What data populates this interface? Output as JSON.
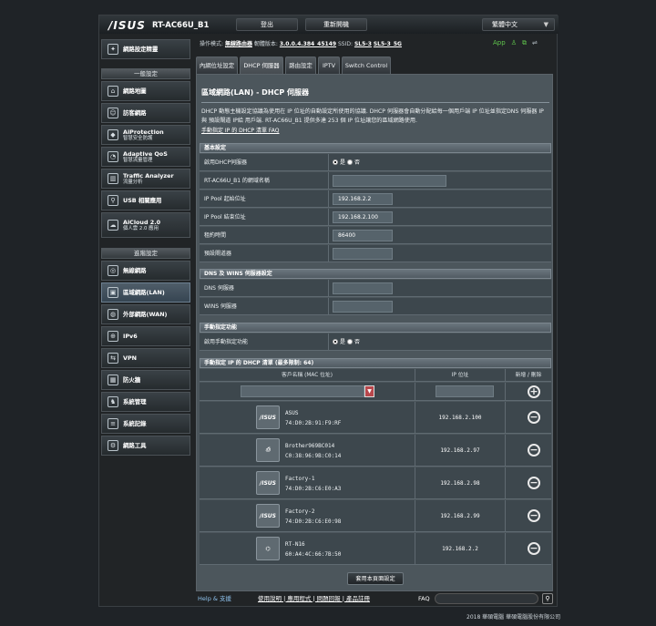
{
  "header": {
    "logo": "/ISUS",
    "model": "RT-AC66U_B1",
    "logout": "登出",
    "reboot": "重新開機",
    "language": "繁體中文"
  },
  "op_bar": {
    "mode_label": "操作模式:",
    "mode": "無線路由器",
    "fw_label": "韌體版本:",
    "fw": "3.0.0.4.384_45149",
    "ssid_label": "SSID:",
    "ssid1": "SL5-3",
    "ssid2": "SL5-3_5G",
    "app": "App"
  },
  "sidebar": {
    "quick": "網路設定精靈",
    "general_header": "一般設定",
    "general": [
      {
        "label": "網路地圖",
        "sub": ""
      },
      {
        "label": "訪客網路",
        "sub": ""
      },
      {
        "label": "AiProtection",
        "sub": "智慧安全防護"
      },
      {
        "label": "Adaptive QoS",
        "sub": "智慧流量管理"
      },
      {
        "label": "Traffic Analyzer",
        "sub": "流量分析"
      },
      {
        "label": "USB 相關應用",
        "sub": ""
      },
      {
        "label": "AiCloud 2.0",
        "sub": "個人雲 2.0 應用"
      }
    ],
    "advanced_header": "進階設定",
    "advanced": [
      {
        "label": "無線網路"
      },
      {
        "label": "區域網路(LAN)"
      },
      {
        "label": "外部網路(WAN)"
      },
      {
        "label": "IPv6"
      },
      {
        "label": "VPN"
      },
      {
        "label": "防火牆"
      },
      {
        "label": "系統管理"
      },
      {
        "label": "系統記錄"
      },
      {
        "label": "網路工具"
      }
    ]
  },
  "tabs": [
    "內網位址設定",
    "DHCP 伺服器",
    "路由設定",
    "IPTV",
    "Switch Control"
  ],
  "page": {
    "title": "區域網路(LAN) - DHCP 伺服器",
    "desc": "DHCP 動態主機設定協議為使用在 IP 位址的自動設定所使用的協議. DHCP 伺服器會自動分配給每一個用戶端 IP 位址並指定DNS 伺服器 IP 與 預設閘道 IP給 用戶端. RT-AC66U_B1 提供多達 253 個 IP 位址讓您的區域網路使用.",
    "link": "手動指定 IP 的 DHCP 清單 FAQ"
  },
  "basic": {
    "header": "基本設定",
    "enable_label": "啟用DHCP伺服器",
    "yes": "是",
    "no": "否",
    "domain_label": "RT-AC66U_B1 的網域名稱",
    "domain_value": "",
    "start_label": "IP Pool 起始位址",
    "start_value": "192.168.2.2",
    "end_label": "IP Pool 結束位址",
    "end_value": "192.168.2.100",
    "lease_label": "租約時間",
    "lease_value": "86400",
    "gw_label": "預設閘道器",
    "gw_value": ""
  },
  "dns": {
    "header": "DNS 及 WINS 伺服器設定",
    "dns_label": "DNS 伺服器",
    "wins_label": "WINS 伺服器"
  },
  "manual": {
    "header": "手動指定功能",
    "enable_label": "啟用手動指定功能",
    "yes": "是",
    "no": "否"
  },
  "list": {
    "header": "手動指定 IP 的 DHCP 清單 (最多限制: 64)",
    "col_client": "客戶名稱 (MAC 位址)",
    "col_ip": "IP 位址",
    "col_action": "新增 / 刪除",
    "rows": [
      {
        "name": "ASUS",
        "mac": "74:D0:2B:91:F9:RF",
        "ip": "192.168.2.100",
        "icon": "asus-logo"
      },
      {
        "name": "Brother969BC014",
        "mac": "C0:38:96:9B:C0:14",
        "ip": "192.168.2.97",
        "icon": "printer-icon"
      },
      {
        "name": "Factory-1",
        "mac": "74:D0:2B:C6:E0:A3",
        "ip": "192.168.2.98",
        "icon": "asus-logo"
      },
      {
        "name": "Factory-2",
        "mac": "74:D0:2B:C6:E0:98",
        "ip": "192.168.2.99",
        "icon": "asus-logo"
      },
      {
        "name": "RT-N16",
        "mac": "60:A4:4C:66:7B:50",
        "ip": "192.168.2.2",
        "icon": "router-icon"
      }
    ]
  },
  "apply": "套用本頁面設定",
  "footer": {
    "help": "Help & 支援",
    "links": "使用說明 | 應用程式 | 問題回報 | 產品註冊",
    "faq": "FAQ",
    "copyright": "2018 華碩電腦 華碩電腦股份有限公司"
  }
}
